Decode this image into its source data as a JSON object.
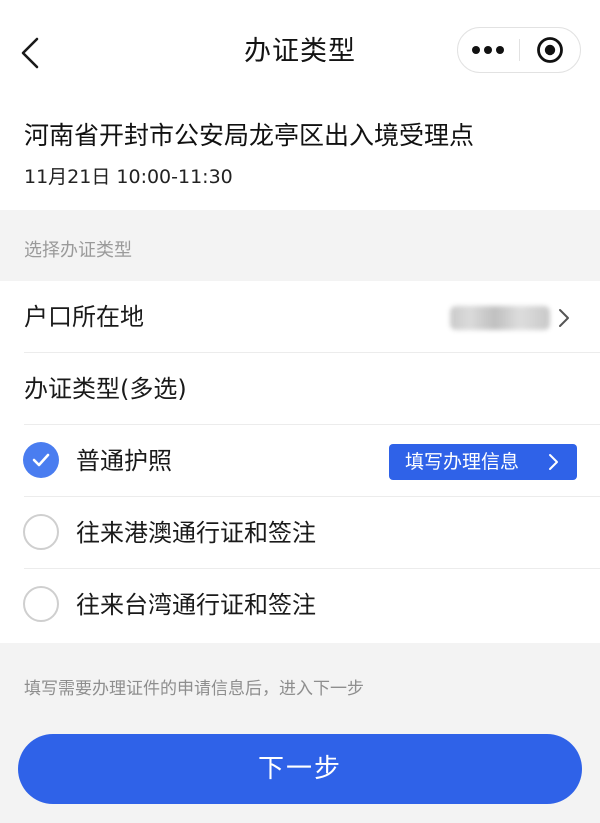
{
  "nav": {
    "title": "办证类型",
    "more_icon": "more-dots-icon",
    "close_icon": "target-close-icon",
    "back_icon": "chevron-left-icon"
  },
  "site": {
    "name": "河南省开封市公安局龙亭区出入境受理点",
    "time": "11月21日 10:00-11:30"
  },
  "section": {
    "label": "选择办证类型"
  },
  "form": {
    "residence_label": "户口所在地",
    "types_label": "办证类型(多选)",
    "options": [
      {
        "label": "普通护照",
        "checked": true
      },
      {
        "label": "往来港澳通行证和签注",
        "checked": false
      },
      {
        "label": "往来台湾通行证和签注",
        "checked": false
      }
    ],
    "fill_button": "填写办理信息"
  },
  "hint": "填写需要办理证件的申请信息后，进入下一步",
  "next_button": "下一步",
  "colors": {
    "primary": "#2f62e8",
    "check": "#4a7df0",
    "background": "#f3f3f3"
  }
}
